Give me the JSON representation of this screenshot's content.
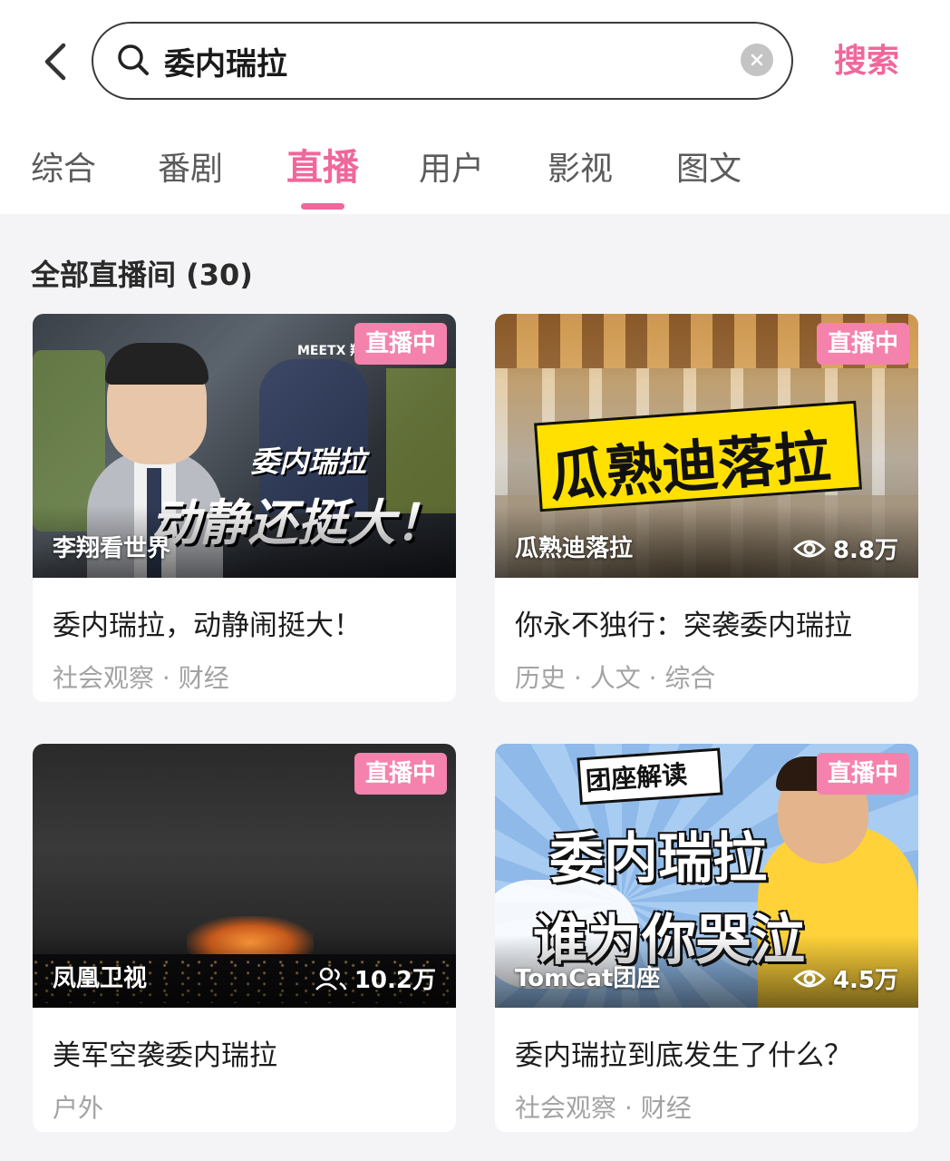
{
  "search": {
    "query": "委内瑞拉",
    "button_label": "搜索"
  },
  "tabs": [
    {
      "label": "综合"
    },
    {
      "label": "番剧"
    },
    {
      "label": "直播",
      "active": true
    },
    {
      "label": "用户"
    },
    {
      "label": "影视"
    },
    {
      "label": "图文"
    }
  ],
  "section_title": "全部直播间 (30)",
  "colors": {
    "accent": "#f0679b",
    "badge": "#f582ac"
  },
  "cards": [
    {
      "live_badge": "直播中",
      "streamer": "李翔看世界",
      "viewers": "",
      "thumb_text_1": "委内瑞拉",
      "thumb_text_2": "动静还挺大！",
      "thumb_logo": "MEETX 翔谈世界",
      "title": "委内瑞拉，动静闹挺大！",
      "tags": "社会观察 · 财经"
    },
    {
      "live_badge": "直播中",
      "streamer": "瓜熟迪落拉",
      "viewers": "8.8万",
      "thumb_text_1": "瓜熟迪落拉",
      "title": "你永不独行：突袭委内瑞拉",
      "tags": "历史 · 人文 · 综合"
    },
    {
      "live_badge": "直播中",
      "streamer": "凤凰卫视",
      "viewers": "10.2万",
      "title": "美军空袭委内瑞拉",
      "tags": "户外"
    },
    {
      "live_badge": "直播中",
      "streamer": "TomCat团座",
      "viewers": "4.5万",
      "thumb_text_0": "团座解读",
      "thumb_text_1": "委内瑞拉",
      "thumb_text_2": "谁为你哭泣",
      "title": "委内瑞拉到底发生了什么？",
      "tags": "社会观察 · 财经"
    }
  ]
}
